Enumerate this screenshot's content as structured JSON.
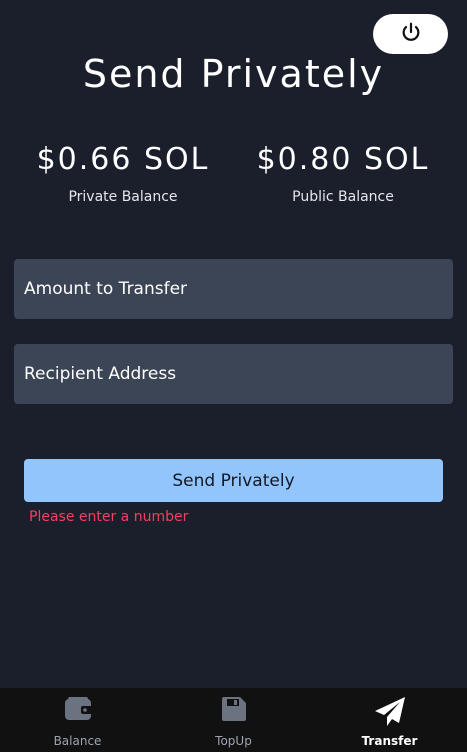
{
  "header": {
    "title": "Send Privately"
  },
  "balances": {
    "private": {
      "amount": "$0.66 SOL",
      "label": "Private Balance"
    },
    "public": {
      "amount": "$0.80 SOL",
      "label": "Public Balance"
    }
  },
  "form": {
    "amount_placeholder": "Amount to Transfer",
    "recipient_placeholder": "Recipient Address",
    "submit_label": "Send Privately",
    "error": "Please enter a number"
  },
  "nav": {
    "items": [
      {
        "label": "Balance",
        "icon": "wallet-icon",
        "active": false
      },
      {
        "label": "TopUp",
        "icon": "floppy-disk-icon",
        "active": false
      },
      {
        "label": "Transfer",
        "icon": "paper-plane-icon",
        "active": true
      }
    ]
  },
  "colors": {
    "background": "#1a1f2b",
    "input_bg": "#3b4556",
    "button_bg": "#93c5fd",
    "error": "#f43f5e",
    "nav_bg": "#111111"
  }
}
